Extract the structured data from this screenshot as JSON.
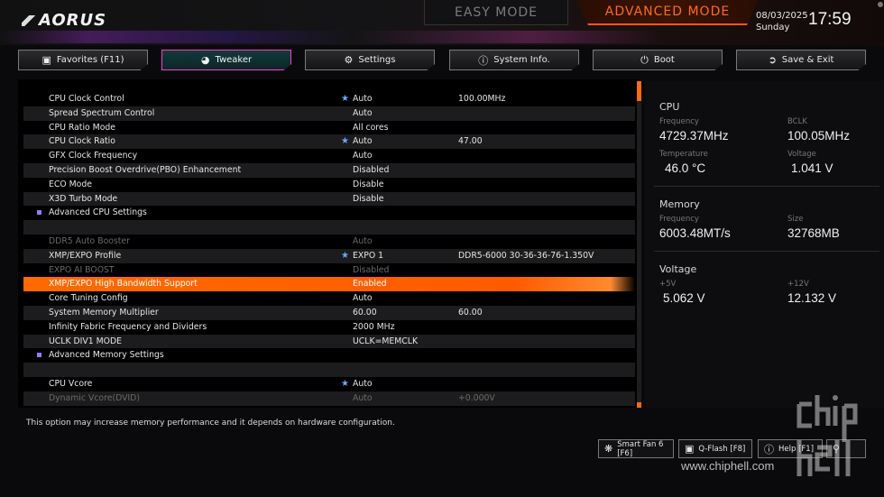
{
  "header": {
    "brand": "AORUS",
    "mode_easy": "EASY MODE",
    "mode_advanced": "ADVANCED MODE",
    "date": "08/03/2025",
    "day": "Sunday",
    "time": "17:59"
  },
  "tabs": [
    {
      "label": "Favorites (F11)",
      "icon": "folder-star-icon"
    },
    {
      "label": "Tweaker",
      "icon": "speedometer-icon"
    },
    {
      "label": "Settings",
      "icon": "gear-icon"
    },
    {
      "label": "System Info.",
      "icon": "info-icon"
    },
    {
      "label": "Boot",
      "icon": "power-icon"
    },
    {
      "label": "Save & Exit",
      "icon": "exit-icon"
    }
  ],
  "rows": [
    {
      "label": "CPU Clock Control",
      "value": "Auto",
      "value2": "100.00MHz",
      "star": true
    },
    {
      "label": "Spread Spectrum Control",
      "value": "Auto",
      "value2": ""
    },
    {
      "label": "CPU Ratio Mode",
      "value": "All cores",
      "value2": ""
    },
    {
      "label": "CPU Clock Ratio",
      "value": "Auto",
      "value2": "47.00",
      "star": true
    },
    {
      "label": "GFX Clock Frequency",
      "value": "Auto",
      "value2": ""
    },
    {
      "label": "Precision Boost Overdrive(PBO) Enhancement",
      "value": "Disabled",
      "value2": ""
    },
    {
      "label": "ECO Mode",
      "value": "Disable",
      "value2": ""
    },
    {
      "label": "X3D Turbo Mode",
      "value": "Disable",
      "value2": ""
    },
    {
      "label": "Advanced CPU Settings",
      "value": "",
      "value2": ""
    },
    {
      "label": "",
      "value": "",
      "value2": ""
    },
    {
      "label": "DDR5 Auto Booster",
      "value": "Auto",
      "value2": ""
    },
    {
      "label": "XMP/EXPO Profile",
      "value": "EXPO 1",
      "value2": "DDR5-6000 30-36-36-76-1.350V",
      "star": true
    },
    {
      "label": "EXPO AI BOOST",
      "value": "Disabled",
      "value2": ""
    },
    {
      "label": "XMP/EXPO High Bandwidth Support",
      "value": "Enabled",
      "value2": ""
    },
    {
      "label": "Core Tuning Config",
      "value": "Auto",
      "value2": ""
    },
    {
      "label": "System Memory Multiplier",
      "value": "60.00",
      "value2": "60.00"
    },
    {
      "label": "Infinity Fabric Frequency and Dividers",
      "value": "2000 MHz",
      "value2": ""
    },
    {
      "label": "UCLK DIV1 MODE",
      "value": "UCLK=MEMCLK",
      "value2": ""
    },
    {
      "label": "Advanced Memory Settings",
      "value": "",
      "value2": ""
    },
    {
      "label": "",
      "value": "",
      "value2": ""
    },
    {
      "label": "CPU Vcore",
      "value": "Auto",
      "value2": "",
      "star": true
    },
    {
      "label": "Dynamic Vcore(DVID)",
      "value": "Auto",
      "value2": "+0.000V"
    }
  ],
  "monitor": {
    "cpu": {
      "title": "CPU",
      "freq_label": "Frequency",
      "freq": "4729.37MHz",
      "bclk_label": "BCLK",
      "bclk": "100.05MHz",
      "temp_label": "Temperature",
      "temp": "46.0 °C",
      "volt_label": "Voltage",
      "volt": "1.041 V"
    },
    "memory": {
      "title": "Memory",
      "freq_label": "Frequency",
      "freq": "6003.48MT/s",
      "size_label": "Size",
      "size": "32768MB"
    },
    "voltage": {
      "title": "Voltage",
      "p5_label": "+5V",
      "p5": "5.062 V",
      "p12_label": "+12V",
      "p12": "12.132 V"
    }
  },
  "description": "This option may increase memory performance and it depends on hardware configuration.",
  "footer": {
    "smart_fan": "Smart Fan 6 [F6]",
    "qflash": "Q-Flash [F8]",
    "help": "Help [F1]",
    "watermark": "www.chiphell.com"
  },
  "colors": {
    "accent": "#ff6a00",
    "tab_active_border": "#ff3ccf",
    "section_bullet": "#8e7dff"
  }
}
